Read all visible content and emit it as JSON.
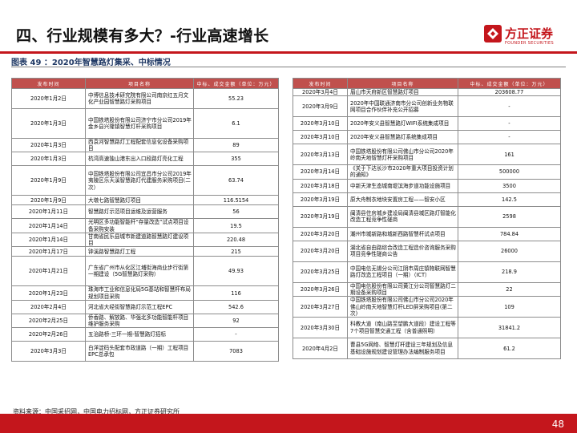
{
  "page": {
    "title": "四、行业规模有多大？-行业高速增长",
    "logo_cn": "方正证券",
    "logo_en": "FOUNDER SECURITIES",
    "caption": "图表 49 ：2020年智慧路灯集采、中标情况",
    "source": "资料来源：中国采招网，中国电力招标网，方正证券研究所",
    "page_number": "48",
    "brand_color": "#c4161c",
    "header_color": "#c0504d"
  },
  "table_headers": [
    "发布时间",
    "项目名称",
    "中标、成交金额（单位：万元）"
  ],
  "left_rows": [
    {
      "date": "2020年1月2日",
      "name": "中博信息技术研究院有限公司南京红五月文化产业园智慧路灯采购项目",
      "amount": "55.23"
    },
    {
      "date": "2020年1月3日",
      "name": "中国铁塔股份有限公司济宁市分公司2019年金乡县兴隆镇智慧灯杆采购项目",
      "amount": "6.1"
    },
    {
      "date": "2020年1月3日",
      "name": "西袁河智慧路灯工程配套信息化设备采购项目",
      "amount": "89"
    },
    {
      "date": "2020年1月3日",
      "name": "杭湾高速独山港东出入口段路灯亮化工程",
      "amount": "355"
    },
    {
      "date": "2020年1月9日",
      "name": "中国铁塔股份有限公司宜昌市分公司2019年夷陵区乐天溪智慧路灯代建服务采购项目(二次）",
      "amount": "63.74"
    },
    {
      "date": "2020年1月9日",
      "name": "大墩七路智慧路灯项目",
      "amount": "116.5154"
    },
    {
      "date": "2020年1月11日",
      "name": "智慧路灯示范项目运维及运营服务",
      "amount": "56"
    },
    {
      "date": "2020年1月14日",
      "name": "光明区多功能智能杆“存量改造”试点项目设备采购安装",
      "amount": "19.5"
    },
    {
      "date": "2020年1月14日",
      "name": "甘南省民乐县城市新建道路智慧路灯建设项目",
      "amount": "220.48"
    },
    {
      "date": "2020年1月17日",
      "name": "钟溪路智慧路灯工程",
      "amount": "215"
    },
    {
      "date": "2020年1月21日",
      "name": "广东省广州市从化区江埔街海商业步行街第一期建设（5G智慧路灯采购）",
      "amount": "49.93"
    },
    {
      "date": "2020年1月23日",
      "name": "珠海市工业和信息化局5G基站和智慧杆布局规划项目采购",
      "amount": "116"
    },
    {
      "date": "2020年2月4日",
      "name": "河北省大经街智慧路灯示范工程EPC",
      "amount": "542.6"
    },
    {
      "date": "2020年2月25日",
      "name": "侨香路、解放路、华强北多功能智能杆项目维护服务采购",
      "amount": "92"
    },
    {
      "date": "2020年2月26日",
      "name": "五治路桥-三环一期-智慧路灯招标",
      "amount": "-"
    },
    {
      "date": "2020年3月3日",
      "name": "白洋淀码头配套市政道路（一期）工程项目EPC总承包",
      "amount": "7083"
    }
  ],
  "right_rows": [
    {
      "date": "2020年3月4日",
      "name": "眉山市天府新区智慧路灯项目",
      "amount": "203608.77"
    },
    {
      "date": "2020年3月9日",
      "name": "2020年中国联通济南市分公司创新业务物联网项目合作伙伴补充公开招募",
      "amount": "-"
    },
    {
      "date": "2020年3月10日",
      "name": "2020年安义县智慧路灯WIFI系统集成项目",
      "amount": "-"
    },
    {
      "date": "2020年3月10日",
      "name": "2020年安义县智慧路灯系统集成项目",
      "amount": "-"
    },
    {
      "date": "2020年3月13日",
      "name": "中国铁塔股份有限公司佛山市分公司2020年岭南天地智慧灯杆采购项目",
      "amount": "161"
    },
    {
      "date": "2020年3月14日",
      "name": "《关于下达长沙市2020年重大项目投资计划的通知》",
      "amount": "500000"
    },
    {
      "date": "2020年3月18日",
      "name": "中新天津生态城南堤滨海步道功能设施项目",
      "amount": "3500"
    },
    {
      "date": "2020年3月19日",
      "name": "原大舟制衣地块安置房工程——智安小区",
      "amount": "142.5"
    },
    {
      "date": "2020年3月19日",
      "name": "闽清县住房城乡建设局闽清县城区路灯智能化改造工程竞争性磋商",
      "amount": "2598"
    },
    {
      "date": "2020年3月20日",
      "name": "潮州市城新路和城新西路智慧杆试点项目",
      "amount": "784.84"
    },
    {
      "date": "2020年3月20日",
      "name": "湖北省自由路综合改造工程造价咨询服务采购项目竞争性磋商公告",
      "amount": "26000"
    },
    {
      "date": "2020年3月25日",
      "name": "中国电信无锡分公司江阴市周庄镇物联网智慧路灯改造工程项目（一期）（ICT）",
      "amount": "218.9"
    },
    {
      "date": "2020年3月26日",
      "name": "中国电信股份有限公司黄江分公司智慧路灯二期设备采购项目",
      "amount": "22"
    },
    {
      "date": "2020年3月27日",
      "name": "中国铁塔股份有限公司佛山市分公司2020年佛山岭南天地智慧灯杆LED屏采购项目(第二次)",
      "amount": "109"
    },
    {
      "date": "2020年3月30日",
      "name": "科教大道（南山路至望鹏大道段）建设工程等7个项目智慧交通工程（含普通照明）",
      "amount": "31841.2"
    },
    {
      "date": "2020年4月2日",
      "name": "曹县5G网络、智慧灯杆建设三年规划及信息基础设施规划建设管理办法编制服务项目",
      "amount": "61.2"
    }
  ]
}
